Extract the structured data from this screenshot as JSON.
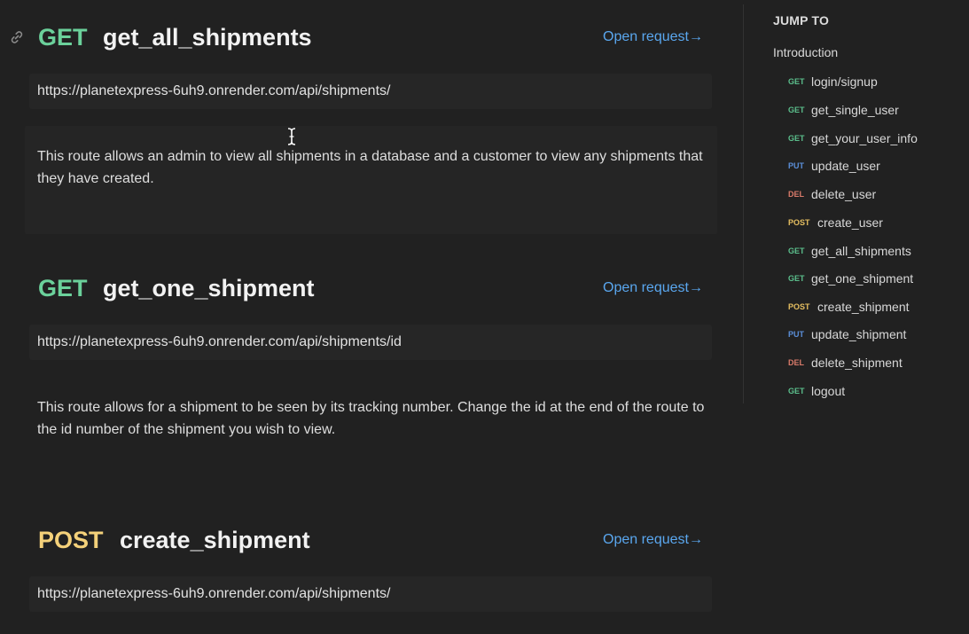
{
  "sections": [
    {
      "method": "GET",
      "name": "get_all_shipments",
      "open_request": "Open request→",
      "url": "https://planetexpress-6uh9.onrender.com/api/shipments/",
      "description": "This route allows an admin to view all shipments in a database and a customer to view any shipments that they have created."
    },
    {
      "method": "GET",
      "name": "get_one_shipment",
      "open_request": "Open request→",
      "url": "https://planetexpress-6uh9.onrender.com/api/shipments/id",
      "description": "This route allows for a shipment to be seen by its tracking number. Change the id at the end of the route to the id number of the shipment you wish to view."
    },
    {
      "method": "POST",
      "name": "create_shipment",
      "open_request": "Open request→",
      "url": "https://planetexpress-6uh9.onrender.com/api/shipments/"
    }
  ],
  "sidebar": {
    "title": "JUMP TO",
    "intro": "Introduction",
    "items": [
      {
        "method": "GET",
        "label": "login/signup"
      },
      {
        "method": "GET",
        "label": "get_single_user"
      },
      {
        "method": "GET",
        "label": "get_your_user_info"
      },
      {
        "method": "PUT",
        "label": "update_user"
      },
      {
        "method": "DEL",
        "label": "delete_user"
      },
      {
        "method": "POST",
        "label": "create_user"
      },
      {
        "method": "GET",
        "label": "get_all_shipments"
      },
      {
        "method": "GET",
        "label": "get_one_shipment"
      },
      {
        "method": "POST",
        "label": "create_shipment"
      },
      {
        "method": "PUT",
        "label": "update_shipment"
      },
      {
        "method": "DEL",
        "label": "delete_shipment"
      },
      {
        "method": "GET",
        "label": "logout"
      }
    ]
  },
  "colors": {
    "background": "#212121",
    "get": "#6bd19b",
    "post": "#f4d17a",
    "put": "#5b8fd9",
    "del": "#d97a6a",
    "link": "#5aa7ef"
  },
  "icons": {
    "anchor": "link-icon",
    "cursor": "text-cursor-icon"
  }
}
